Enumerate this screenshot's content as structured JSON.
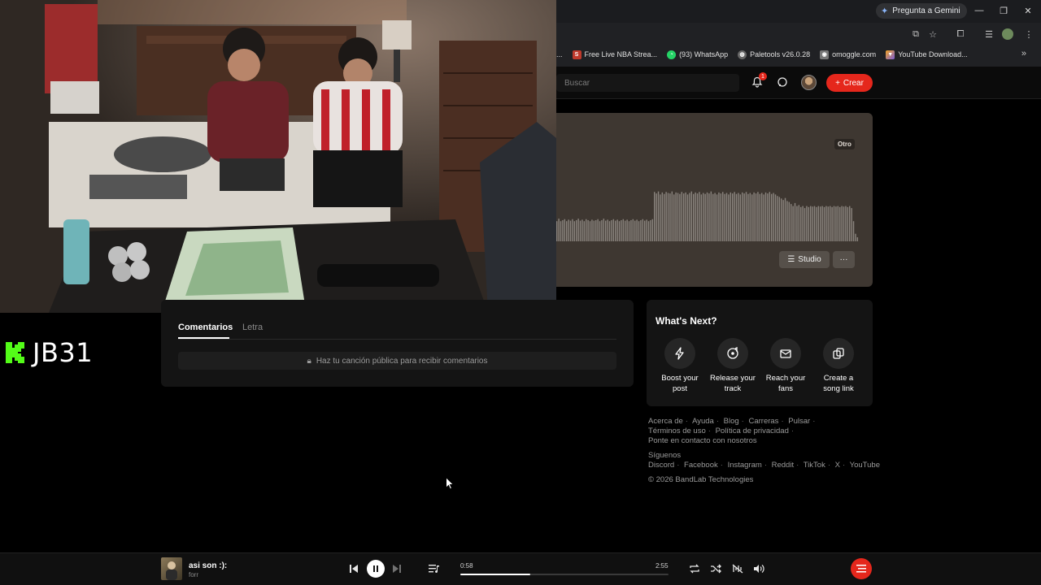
{
  "browser": {
    "gemini_label": "Pregunta a Gemini",
    "bookmarks": [
      {
        "label": "Free Live NBA Strea...",
        "icon": "s-icon",
        "color": "#c0392b"
      },
      {
        "label": "(93) WhatsApp",
        "icon": "whatsapp-icon",
        "color": "#25d366"
      },
      {
        "label": "Paletools v26.0.28",
        "icon": "paletools-icon",
        "color": "#888888"
      },
      {
        "label": "omoggle.com",
        "icon": "omoggle-icon",
        "color": "#999999"
      },
      {
        "label": "YouTube Download...",
        "icon": "youtube-dl-icon",
        "color": "#7b5cd6"
      }
    ],
    "bookmark_overflow": "..."
  },
  "header": {
    "search_placeholder": "Buscar",
    "notification_count": "1",
    "create_label": "Crear"
  },
  "track_card": {
    "badge": "Otro",
    "studio_label": "Studio",
    "more_label": "···"
  },
  "waveform_data": {
    "bar_levels": [
      0.4,
      0.45,
      0.4,
      0.42,
      0.44,
      0.4,
      0.43,
      0.41,
      0.44,
      0.4,
      0.42,
      0.45,
      0.41,
      0.43,
      0.4,
      0.44,
      0.42,
      0.4,
      0.43,
      0.41,
      0.42,
      0.44,
      0.4,
      0.42,
      0.45,
      0.41,
      0.43,
      0.4,
      0.42,
      0.44,
      0.41,
      0.43,
      0.4,
      0.42,
      0.44,
      0.41,
      0.43,
      0.4,
      0.42,
      0.44,
      0.41,
      0.43,
      0.4,
      0.42,
      0.44,
      0.41,
      0.43,
      0.4,
      0.42,
      0.44,
      0.98,
      0.95,
      0.99,
      0.93,
      0.97,
      0.94,
      0.98,
      0.96,
      0.95,
      0.99,
      0.93,
      0.97,
      0.96,
      0.94,
      0.98,
      0.95,
      0.97,
      0.93,
      0.96,
      0.99,
      0.94,
      0.97,
      0.95,
      0.98,
      0.93,
      0.96,
      0.94,
      0.97,
      0.95,
      0.99,
      0.94,
      0.96,
      0.93,
      0.97,
      0.95,
      0.98,
      0.94,
      0.96,
      0.93,
      0.97,
      0.95,
      0.98,
      0.94,
      0.96,
      0.93,
      0.97,
      0.95,
      0.98,
      0.94,
      0.96,
      0.93,
      0.97,
      0.95,
      0.98,
      0.94,
      0.96,
      0.93,
      0.97,
      0.95,
      0.98,
      0.94,
      0.96,
      0.93,
      0.9,
      0.88,
      0.85,
      0.82,
      0.86,
      0.8,
      0.78,
      0.74,
      0.7,
      0.76,
      0.7,
      0.72,
      0.68,
      0.7,
      0.66,
      0.7,
      0.68,
      0.7,
      0.69,
      0.7,
      0.68,
      0.7,
      0.69,
      0.7,
      0.68,
      0.7,
      0.69,
      0.7,
      0.68,
      0.7,
      0.69,
      0.7,
      0.68,
      0.7,
      0.69,
      0.7,
      0.68,
      0.7,
      0.66,
      0.4,
      0.15,
      0.08
    ]
  },
  "streamer": {
    "name": "JB31"
  },
  "comments": {
    "tab_comments": "Comentarios",
    "tab_lyrics": "Letra",
    "public_note": "Haz tu canción pública para recibir comentarios"
  },
  "whats_next": {
    "title": "What's Next?",
    "items": [
      {
        "line1": "Boost your",
        "line2": "post",
        "icon": "bolt-icon"
      },
      {
        "line1": "Release your",
        "line2": "track",
        "icon": "release-icon"
      },
      {
        "line1": "Reach your",
        "line2": "fans",
        "icon": "mail-icon"
      },
      {
        "line1": "Create a",
        "line2": "song link",
        "icon": "link-icon"
      }
    ]
  },
  "footer": {
    "row1": [
      "Acerca de",
      "Ayuda",
      "Blog",
      "Carreras",
      "Pulsar"
    ],
    "row2": [
      "Términos de uso",
      "Política de privacidad"
    ],
    "row3": "Ponte en contacto con nosotros",
    "follow_label": "Síguenos",
    "social": [
      "Discord",
      "Facebook",
      "Instagram",
      "Reddit",
      "TikTok",
      "X",
      "YouTube"
    ],
    "copyright": "© 2026 BandLab Technologies"
  },
  "player": {
    "title": "asi son :):",
    "artist": "forr",
    "current_time": "0:58",
    "total_time": "2:55",
    "progress": 0.335
  }
}
